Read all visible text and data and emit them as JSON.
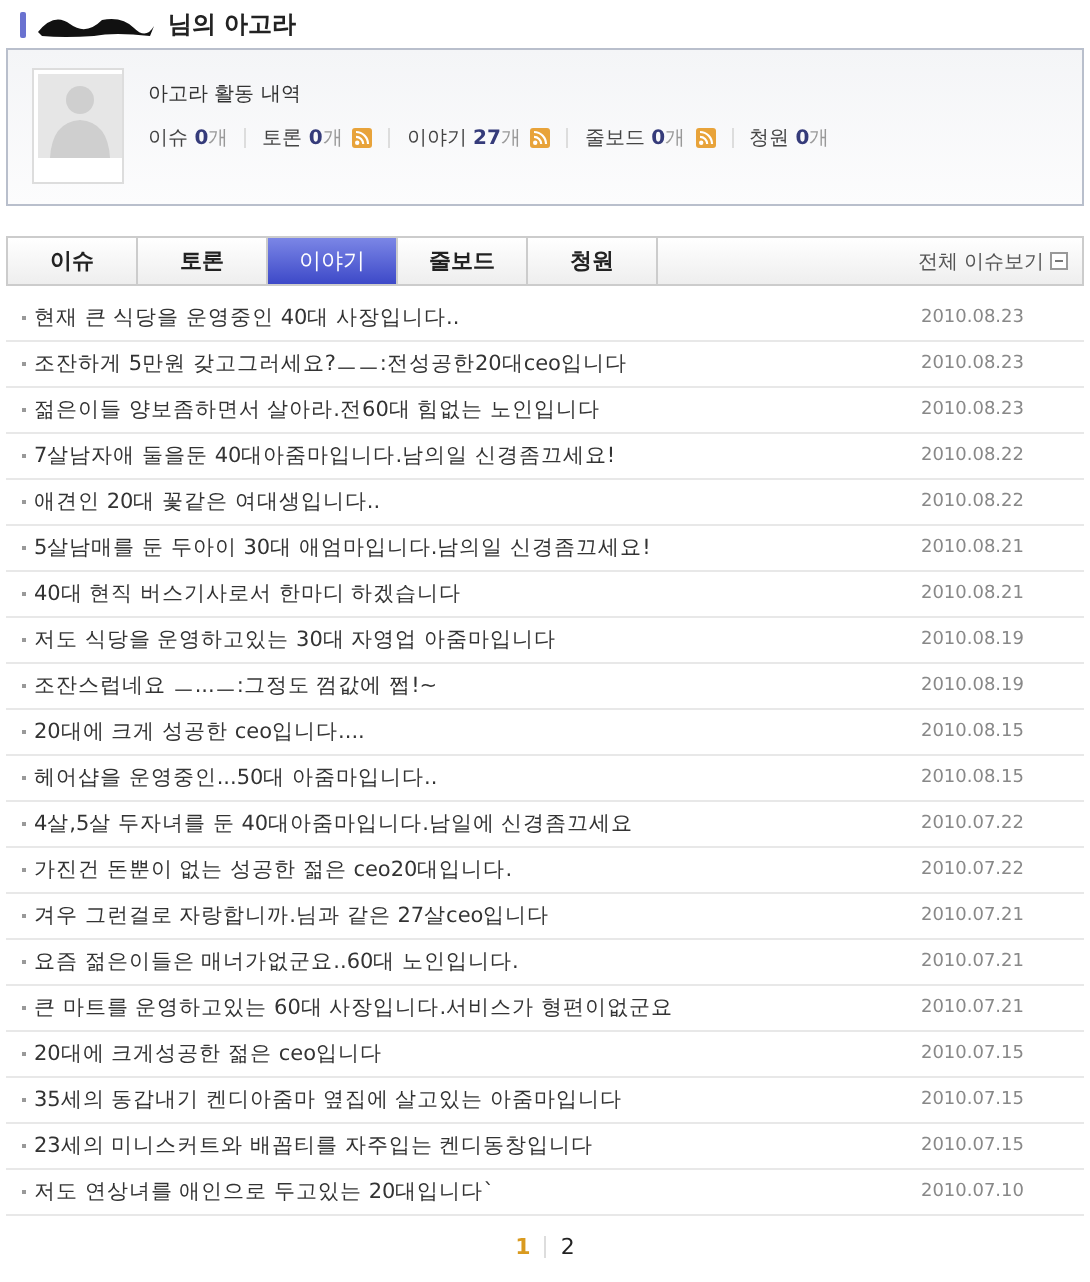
{
  "header": {
    "title": "님의 아고라",
    "name_redacted": true
  },
  "profile": {
    "heading": "아고라 활동 내역",
    "stats": [
      {
        "label": "이슈",
        "count": "0",
        "unit": "개",
        "rss": false
      },
      {
        "label": "토론",
        "count": "0",
        "unit": "개",
        "rss": true
      },
      {
        "label": "이야기",
        "count": "27",
        "unit": "개",
        "rss": true
      },
      {
        "label": "줄보드",
        "count": "0",
        "unit": "개",
        "rss": true
      },
      {
        "label": "청원",
        "count": "0",
        "unit": "개",
        "rss": false
      }
    ]
  },
  "tabs": [
    {
      "label": "이슈",
      "selected": false
    },
    {
      "label": "토론",
      "selected": false
    },
    {
      "label": "이야기",
      "selected": true
    },
    {
      "label": "줄보드",
      "selected": false
    },
    {
      "label": "청원",
      "selected": false
    }
  ],
  "view_all": "전체 이슈보기",
  "posts": [
    {
      "title": "현재 큰 식당을 운영중인 40대 사장입니다..",
      "date": "2010.08.23"
    },
    {
      "title": "조잔하게 5만원 갖고그러세요?ㅡㅡ:전성공한20대ceo입니다",
      "date": "2010.08.23"
    },
    {
      "title": "젊은이들 양보좀하면서 살아라.전60대 힘없는 노인입니다",
      "date": "2010.08.23"
    },
    {
      "title": "7살남자애 둘을둔 40대아줌마입니다.남의일 신경좀끄세요!",
      "date": "2010.08.22"
    },
    {
      "title": "애견인 20대 꽃같은 여대생입니다..",
      "date": "2010.08.22"
    },
    {
      "title": "5살남매를 둔 두아이 30대 애엄마입니다.남의일 신경좀끄세요!",
      "date": "2010.08.21"
    },
    {
      "title": "40대 현직 버스기사로서 한마디 하겠습니다",
      "date": "2010.08.21"
    },
    {
      "title": "저도 식당을 운영하고있는 30대 자영업 아줌마입니다",
      "date": "2010.08.19"
    },
    {
      "title": "조잔스럽네요 ㅡ...ㅡ:그정도 껌값에 쩝!~",
      "date": "2010.08.19"
    },
    {
      "title": "20대에 크게 성공한 ceo입니다....",
      "date": "2010.08.15"
    },
    {
      "title": "헤어샵을 운영중인...50대 아줌마입니다..",
      "date": "2010.08.15"
    },
    {
      "title": "4살,5살 두자녀를 둔 40대아줌마입니다.남일에 신경좀끄세요",
      "date": "2010.07.22"
    },
    {
      "title": "가진건 돈뿐이 없는 성공한 젊은 ceo20대입니다.",
      "date": "2010.07.22"
    },
    {
      "title": "겨우 그런걸로 자랑합니까.님과 같은 27살ceo입니다",
      "date": "2010.07.21"
    },
    {
      "title": "요즘 젊은이들은 매너가없군요..60대 노인입니다.",
      "date": "2010.07.21"
    },
    {
      "title": "큰 마트를 운영하고있는 60대 사장입니다.서비스가 형편이없군요",
      "date": "2010.07.21"
    },
    {
      "title": "20대에 크게성공한 젊은 ceo입니다",
      "date": "2010.07.15"
    },
    {
      "title": "35세의 동갑내기 켄디아줌마 옆집에 살고있는 아줌마입니다",
      "date": "2010.07.15"
    },
    {
      "title": "23세의 미니스커트와 배꼽티를 자주입는 켄디동창입니다",
      "date": "2010.07.15"
    },
    {
      "title": "저도 연상녀를 애인으로 두고있는 20대입니다`",
      "date": "2010.07.10"
    }
  ],
  "pagination": [
    {
      "label": "1",
      "selected": true
    },
    {
      "label": "2",
      "selected": false
    }
  ]
}
